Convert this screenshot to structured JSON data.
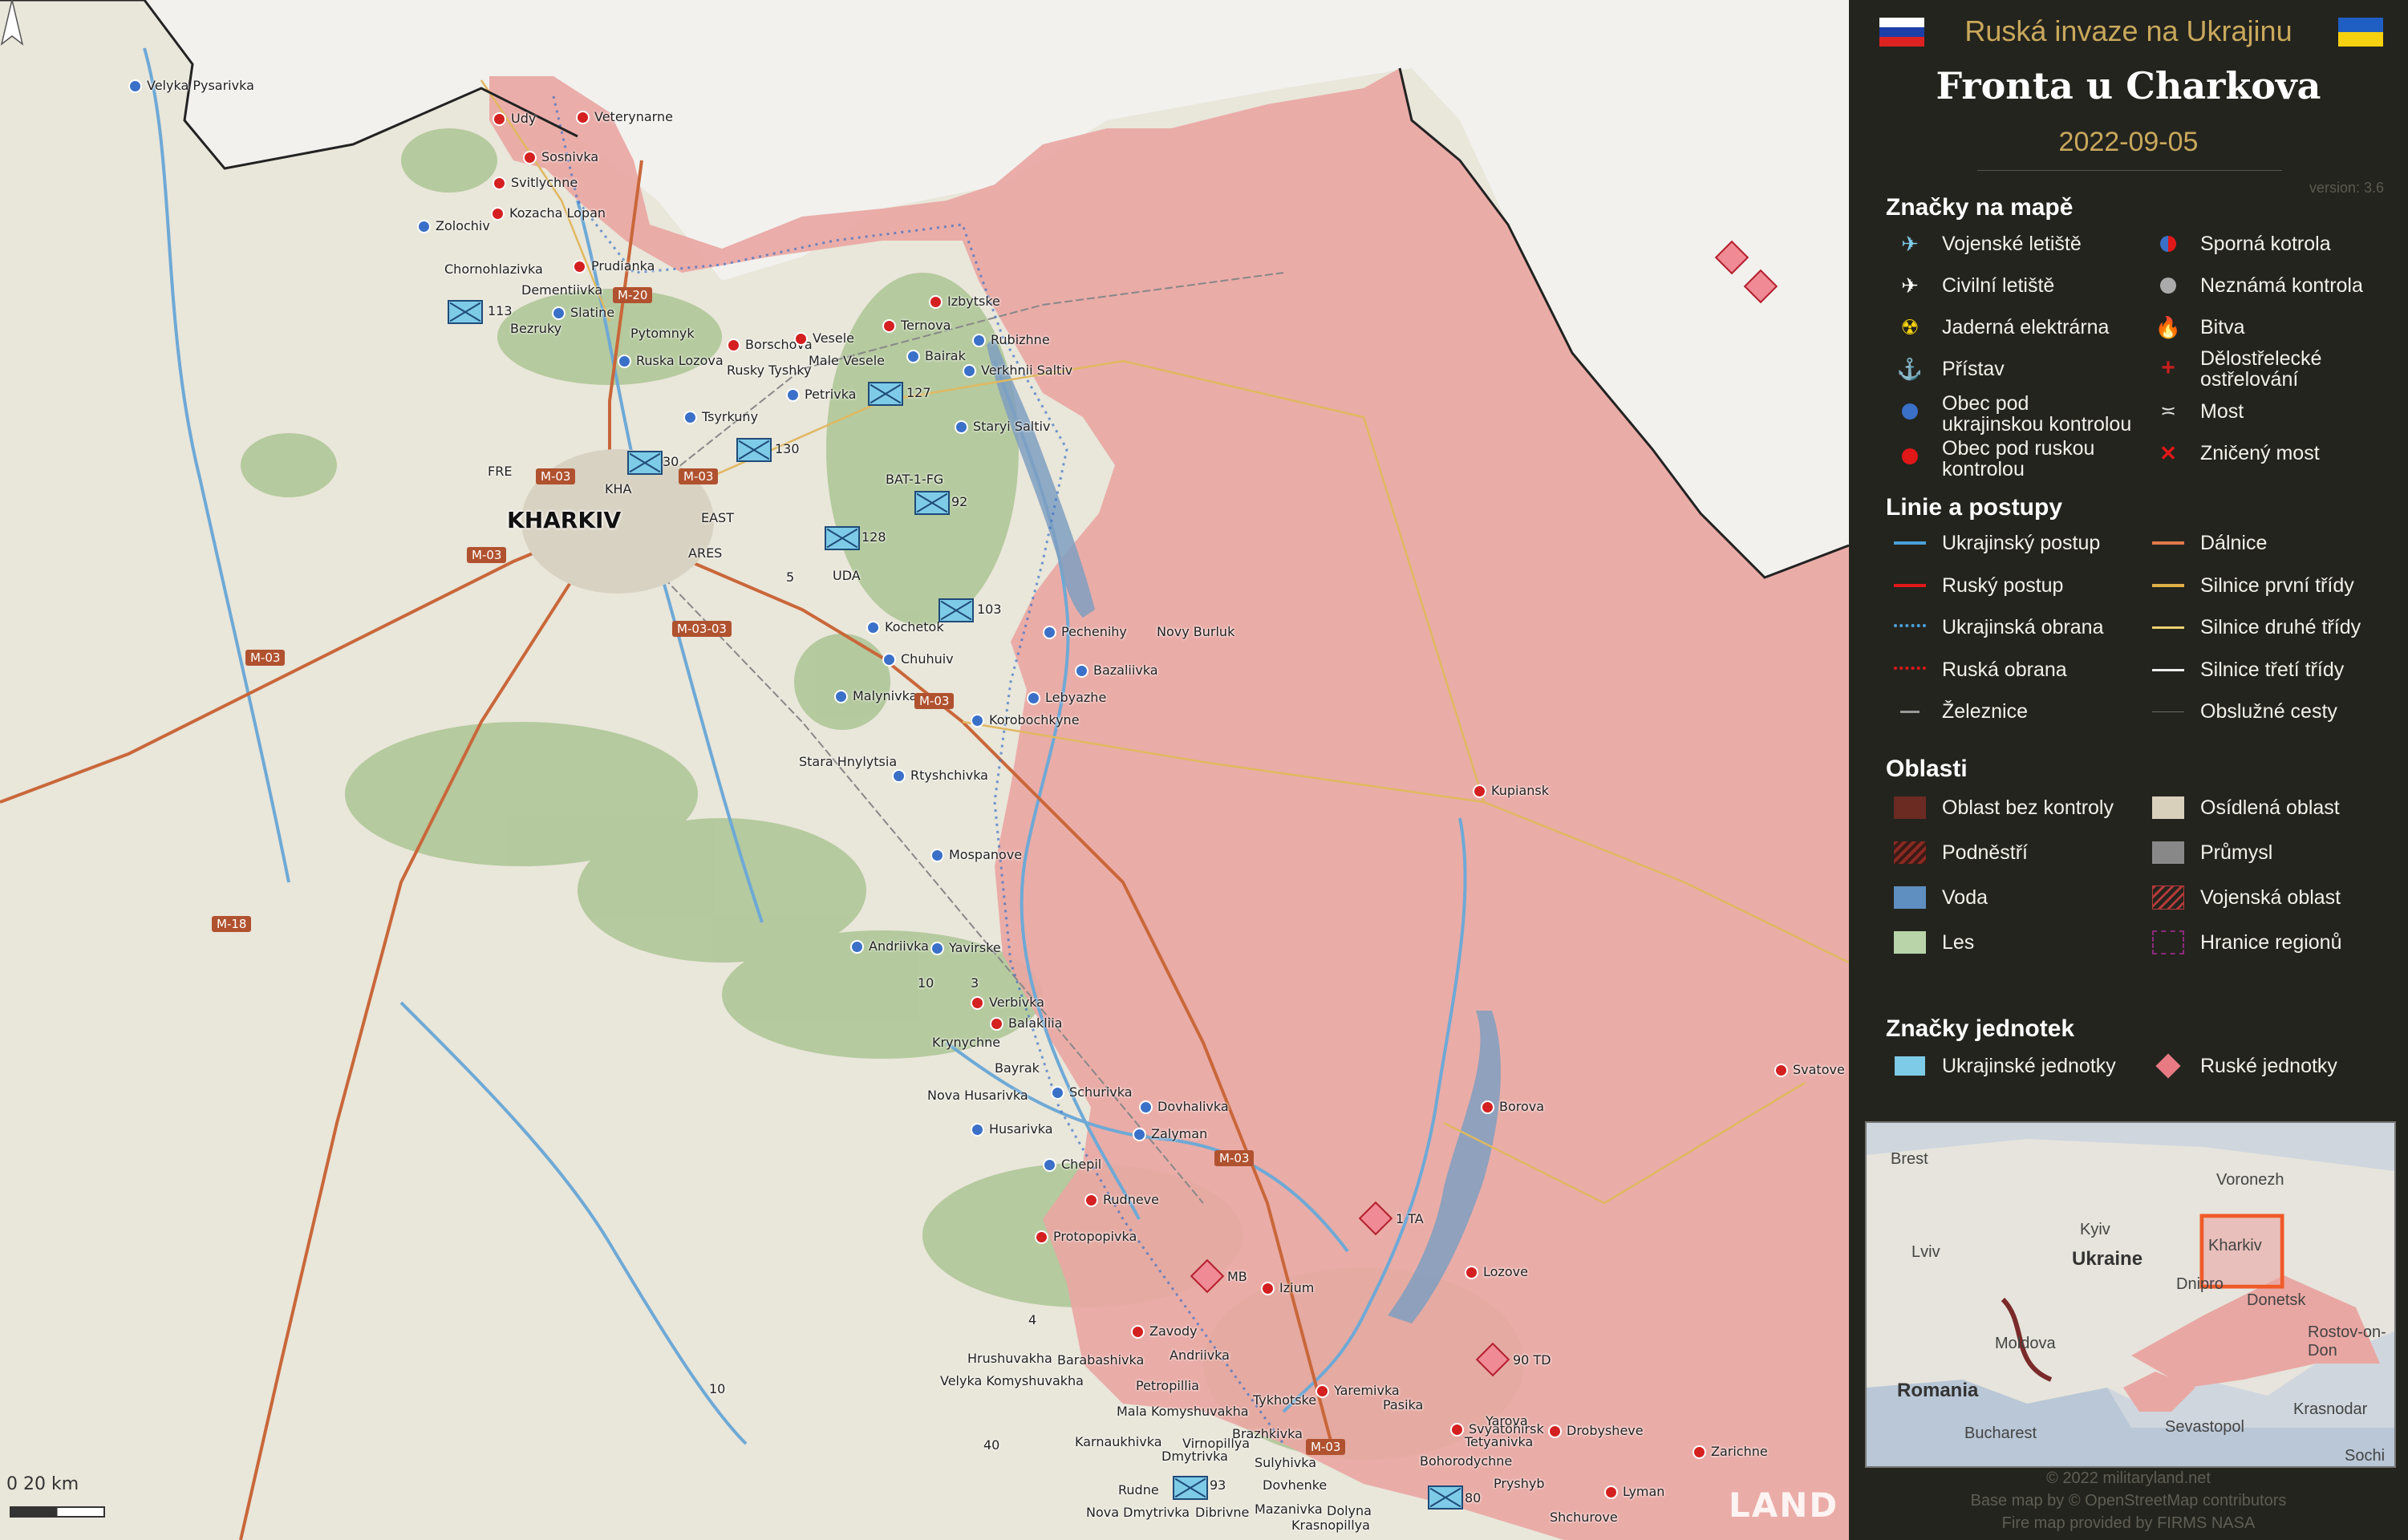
{
  "map": {
    "big_city": "KHARKIV",
    "settlements_ua": [
      {
        "name": "Velyka Pysarivka"
      },
      {
        "name": "Zolochiv"
      },
      {
        "name": "Slatine"
      },
      {
        "name": "Ruska Lozova"
      },
      {
        "name": "Tsyrkuny"
      },
      {
        "name": "Petrivka"
      },
      {
        "name": "Verkhnii Saltiv"
      },
      {
        "name": "Staryi Saltiv"
      },
      {
        "name": "Bairak"
      },
      {
        "name": "Rubizhne"
      },
      {
        "name": "Pechenihy"
      },
      {
        "name": "Chuhuiv"
      },
      {
        "name": "Malynivka"
      },
      {
        "name": "Korobochkyne"
      },
      {
        "name": "Rtyshchivka"
      },
      {
        "name": "Mospanove"
      },
      {
        "name": "Andriivka"
      },
      {
        "name": "Yavirske"
      },
      {
        "name": "Schurivka"
      },
      {
        "name": "Husarivka"
      },
      {
        "name": "Chepil"
      },
      {
        "name": "Dovhalivka"
      },
      {
        "name": "Zalyman"
      },
      {
        "name": "Lebyazhe"
      },
      {
        "name": "Bazaliivka"
      },
      {
        "name": "Kochetok"
      }
    ],
    "settlements_ru": [
      {
        "name": "Udy"
      },
      {
        "name": "Veterynarne"
      },
      {
        "name": "Sosnivka"
      },
      {
        "name": "Svitlychne"
      },
      {
        "name": "Kozacha Lopan"
      },
      {
        "name": "Prudianka"
      },
      {
        "name": "Ternova"
      },
      {
        "name": "Izbytske"
      },
      {
        "name": "Borschova"
      },
      {
        "name": "Vesele"
      },
      {
        "name": "Kupiansk"
      },
      {
        "name": "Borova"
      },
      {
        "name": "Lozove"
      },
      {
        "name": "Izium"
      },
      {
        "name": "Balakliia"
      },
      {
        "name": "Verbivka"
      },
      {
        "name": "Svatove"
      },
      {
        "name": "Zavody"
      },
      {
        "name": "Protopopivka"
      },
      {
        "name": "Rudneve"
      },
      {
        "name": "Yaremivka"
      },
      {
        "name": "Svyatohirsk"
      },
      {
        "name": "Drobysheve"
      },
      {
        "name": "Lyman"
      },
      {
        "name": "Zarichne"
      }
    ],
    "settlements_other": [
      {
        "name": "Chornohlazivka"
      },
      {
        "name": "Dementiivka"
      },
      {
        "name": "Bezruky"
      },
      {
        "name": "Pytomnyk"
      },
      {
        "name": "Rusky Tyshky"
      },
      {
        "name": "Male Vesele"
      },
      {
        "name": "Stara Hnylytsia"
      },
      {
        "name": "Nova Husarivka"
      },
      {
        "name": "Bayrak"
      },
      {
        "name": "Krynychne"
      },
      {
        "name": "Hrushuvakha"
      },
      {
        "name": "Barabashivka"
      },
      {
        "name": "Andriivka"
      },
      {
        "name": "Petropillia"
      },
      {
        "name": "Velyka Komyshuvakha"
      },
      {
        "name": "Mala Komyshuvakha"
      },
      {
        "name": "Tykhotske"
      },
      {
        "name": "Karnaukhivka"
      },
      {
        "name": "Dmytrivka"
      },
      {
        "name": "Virnopillya"
      },
      {
        "name": "Brazhkivka"
      },
      {
        "name": "Sulyhivka"
      },
      {
        "name": "Pasika"
      },
      {
        "name": "Bohorodychne"
      },
      {
        "name": "Yarova"
      },
      {
        "name": "Tetyanivka"
      },
      {
        "name": "Pryshyb"
      },
      {
        "name": "Dovhenke"
      },
      {
        "name": "Rudne"
      },
      {
        "name": "Nova Dmytrivka"
      },
      {
        "name": "Dibrivne"
      },
      {
        "name": "Mazanivka"
      },
      {
        "name": "Dolyna"
      },
      {
        "name": "Krasnopillya"
      },
      {
        "name": "Shchurove"
      },
      {
        "name": "Novy Burluk"
      }
    ],
    "roads": [
      "M-20",
      "M-03",
      "M-03",
      "M-03",
      "M-03-03",
      "M-03",
      "M-03",
      "M-03",
      "M-18",
      "M-03"
    ],
    "unit_labels": [
      "113",
      "130",
      "127",
      "BAT-1-FG",
      "92",
      "128",
      "103",
      "UDA",
      "EAST",
      "ARES",
      "KHA",
      "FRE",
      "30",
      "5",
      "10",
      "3",
      "4",
      "10",
      "40",
      "93",
      "80",
      "1 TA",
      "MB",
      "90 TD"
    ],
    "scale_label": "0     20 km",
    "watermark": "LAND",
    "colors": {
      "russian_controlled": "#e9a7a3",
      "ukraine_land": "#e9e6da",
      "foreign_land": "#f2f1ee",
      "river": "#6ea9d6",
      "forest": "#a3c08a",
      "highway": "#c9673a"
    }
  },
  "panel": {
    "subtitle": "Ruská invaze na Ukrajinu",
    "title": "Fronta u Charkova",
    "date": "2022-09-05",
    "version": "version: 3.6",
    "sections": {
      "markers": "Značky na mapě",
      "lines": "Linie a postupy",
      "areas": "Oblasti",
      "units": "Značky jednotek"
    },
    "markers_left": [
      {
        "label": "Vojenské letiště",
        "icon": "military-airport-icon"
      },
      {
        "label": "Civilní letiště",
        "icon": "civil-airport-icon"
      },
      {
        "label": "Jaderná elektrárna",
        "icon": "nuclear-plant-icon"
      },
      {
        "label": "Přístav",
        "icon": "anchor-icon"
      },
      {
        "label": "Obec pod ukrajinskou kontrolou",
        "icon": "blue-dot-icon"
      },
      {
        "label": "Obec pod ruskou kontrolou",
        "icon": "red-dot-icon"
      }
    ],
    "markers_right": [
      {
        "label": "Sporná kotrola",
        "icon": "contested-icon"
      },
      {
        "label": "Neznámá kontrola",
        "icon": "grey-dot-icon"
      },
      {
        "label": "Bitva",
        "icon": "fire-icon"
      },
      {
        "label": "Dělostřelecké ostřelování",
        "icon": "artillery-icon"
      },
      {
        "label": "Most",
        "icon": "bridge-icon"
      },
      {
        "label": "Zničený most",
        "icon": "destroyed-bridge-icon"
      }
    ],
    "lines_left": [
      "Ukrajinský postup",
      "Ruský postup",
      "Ukrajinská obrana",
      "Ruská obrana",
      "Železnice"
    ],
    "lines_right": [
      "Dálnice",
      "Silnice první třídy",
      "Silnice druhé třídy",
      "Silnice třetí třídy",
      "Obslužné cesty"
    ],
    "areas_left": [
      "Oblast bez kontroly",
      "Podněstří",
      "Voda",
      "Les"
    ],
    "areas_right": [
      "Osídlená oblast",
      "Průmysl",
      "Vojenská oblast",
      "Hranice regionů"
    ],
    "units": [
      "Ukrajinské jednotky",
      "Ruské jednotky"
    ],
    "inset": {
      "cities": [
        "Brest",
        "Voronezh",
        "Kyiv",
        "Lviv",
        "Kharkiv",
        "Dnipro",
        "Donetsk",
        "Rostov-on-Don",
        "Moldova",
        "Krasnodar",
        "Sevastopol",
        "Bucharest",
        "Sochi"
      ],
      "countries": [
        "Ukraine",
        "Romania"
      ]
    },
    "credits": [
      "© 2022 militaryland.net",
      "Base map by © OpenStreetMap contributors",
      "Fire map provided by FIRMS NASA"
    ]
  }
}
